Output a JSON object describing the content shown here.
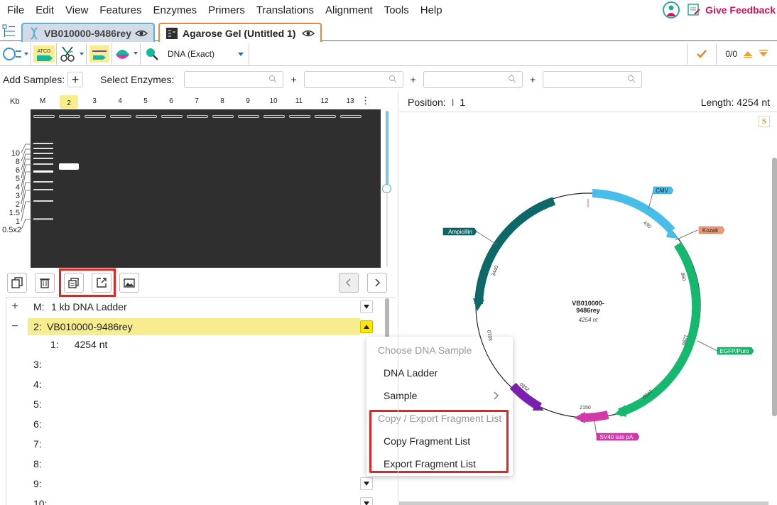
{
  "menu": [
    "File",
    "Edit",
    "View",
    "Features",
    "Enzymes",
    "Primers",
    "Translations",
    "Alignment",
    "Tools",
    "Help"
  ],
  "feedback_label": "Give Feedback",
  "tabs": [
    {
      "label": "VB010000-9486rey"
    },
    {
      "label": "Agarose Gel (Untitled 1)"
    }
  ],
  "toolbar": {
    "search_mode": "DNA (Exact)",
    "match_count": "0/0"
  },
  "samplebar": {
    "add_samples_label": "Add Samples:",
    "add_button": "+",
    "select_enzymes_label": "Select Enzymes:",
    "plus": "+"
  },
  "gel": {
    "kb_label": "Kb",
    "lanes": [
      "M",
      "2",
      "3",
      "4",
      "5",
      "6",
      "7",
      "8",
      "9",
      "10",
      "11",
      "12",
      "13"
    ],
    "more": "⋮",
    "ladder_kb": [
      "10",
      "8",
      "6",
      "5",
      "4",
      "3",
      "2",
      "1.5",
      "1",
      "0.5x2"
    ]
  },
  "sample_list": {
    "rows": [
      {
        "toggle": "+",
        "id": "M:",
        "name": "1 kb DNA Ladder"
      },
      {
        "toggle": "−",
        "id": "2:",
        "name": "VB010000-9486rey"
      },
      {
        "toggle": "",
        "id": "1:",
        "name": "4254 nt"
      },
      {
        "toggle": "",
        "id": "3:",
        "name": ""
      },
      {
        "toggle": "",
        "id": "4:",
        "name": ""
      },
      {
        "toggle": "",
        "id": "5:",
        "name": ""
      },
      {
        "toggle": "",
        "id": "6:",
        "name": ""
      },
      {
        "toggle": "",
        "id": "7:",
        "name": ""
      },
      {
        "toggle": "",
        "id": "8:",
        "name": ""
      },
      {
        "toggle": "",
        "id": "9:",
        "name": ""
      },
      {
        "toggle": "",
        "id": "10:",
        "name": ""
      }
    ]
  },
  "context_menu": {
    "header1": "Choose DNA Sample",
    "dna_ladder": "DNA Ladder",
    "sample": "Sample",
    "header2": "Copy / Export Fragment List",
    "copy": "Copy Fragment List",
    "export": "Export Fragment List"
  },
  "map": {
    "position_label": "Position:",
    "position_value": "1",
    "length_label": "Length: 4254 nt",
    "s_badge": "S",
    "name_line1": "VB010000-",
    "name_line2": "9486rey",
    "length": "4254 nt",
    "features": [
      "CMV",
      "Kozak",
      "EGFP/Puro",
      "SV40 late pA",
      "Ampicillin"
    ],
    "ticks": [
      "430",
      "860",
      "1290",
      "1720",
      "2150",
      "2580",
      "3010",
      "3440"
    ]
  },
  "colors": {
    "cmv": "#48bde8",
    "kozak": "#e89a74",
    "egfp": "#14b86e",
    "sv40": "#d23aa8",
    "purple": "#7a1fb0",
    "ampicillin": "#0e6868",
    "highlight": "#e52421"
  }
}
